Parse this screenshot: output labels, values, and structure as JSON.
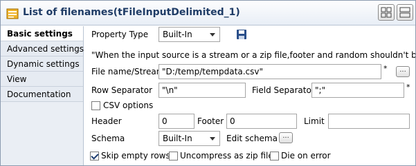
{
  "window": {
    "title": "List of filenames(tFileInputDelimited_1)"
  },
  "sidebar": {
    "items": [
      {
        "label": "Basic settings",
        "active": true
      },
      {
        "label": "Advanced settings",
        "active": false
      },
      {
        "label": "Dynamic settings",
        "active": false
      },
      {
        "label": "View",
        "active": false
      },
      {
        "label": "Documentation",
        "active": false
      }
    ]
  },
  "form": {
    "property_type_label": "Property Type",
    "property_type_value": "Built-In",
    "info_text": "\"When the input source is a stream or a zip file,footer and random shouldn't be bigger th",
    "filename_label": "File name/Stream",
    "filename_value": "\"D:/temp/tempdata.csv\"",
    "required_mark": "*",
    "browse_label": "...",
    "row_sep_label": "Row Separator",
    "row_sep_value": "\"\\n\"",
    "field_sep_label": "Field Separator",
    "field_sep_value": "\";\"",
    "csv_options_label": "CSV options",
    "csv_options_checked": false,
    "header_label": "Header",
    "header_value": "0",
    "footer_label": "Footer",
    "footer_value": "0",
    "limit_label": "Limit",
    "limit_value": "",
    "schema_label": "Schema",
    "schema_value": "Built-In",
    "edit_schema_label": "Edit schema",
    "edit_schema_btn": "...",
    "skip_empty_label": "Skip empty rows",
    "skip_empty_checked": true,
    "uncompress_label": "Uncompress as zip file",
    "uncompress_checked": false,
    "die_on_error_label": "Die on error",
    "die_on_error_checked": false
  },
  "colors": {
    "title_text": "#1f3c66",
    "sidebar_bg": "#eaeef4",
    "border": "#8c9bb0"
  }
}
